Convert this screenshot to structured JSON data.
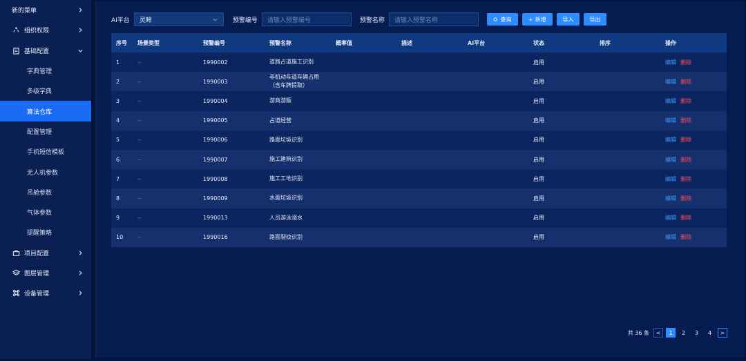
{
  "sidebar": {
    "items": [
      {
        "label": "新的菜单"
      },
      {
        "label": "组织权限"
      },
      {
        "label": "基础配置"
      },
      {
        "label": "项目配置"
      },
      {
        "label": "图层管理"
      },
      {
        "label": "设备管理"
      }
    ],
    "sub_items": [
      {
        "label": "字典管理"
      },
      {
        "label": "多级字典"
      },
      {
        "label": "算法仓库"
      },
      {
        "label": "配置管理"
      },
      {
        "label": "手机短信模板"
      },
      {
        "label": "无人机参数"
      },
      {
        "label": "吊舱参数"
      },
      {
        "label": "气体参数"
      },
      {
        "label": "提醒策略"
      }
    ]
  },
  "filters": {
    "platform_label": "AI平台",
    "platform_value": "灵眸",
    "code_label": "预警编号",
    "code_placeholder": "请输入预警编号",
    "name_label": "预警名称",
    "name_placeholder": "请输入预警名称",
    "query_label": "查询",
    "add_label": "新增",
    "import_label": "导入",
    "export_label": "导出"
  },
  "table": {
    "headers": [
      "序号",
      "场景类型",
      "预警编号",
      "预警名称",
      "概率值",
      "描述",
      "AI平台",
      "状态",
      "排序",
      "操作"
    ],
    "edit_label": "编辑",
    "delete_label": "删除",
    "rows": [
      {
        "idx": "1",
        "scene": "--",
        "code": "1990002",
        "name": "道路占道施工识别",
        "name2": "",
        "status": "启用"
      },
      {
        "idx": "2",
        "scene": "--",
        "code": "1990003",
        "name": "非机动车道车辆占用",
        "name2": "（含车牌提取）",
        "status": "启用"
      },
      {
        "idx": "3",
        "scene": "--",
        "code": "1990004",
        "name": "游商游贩",
        "name2": "",
        "status": "启用"
      },
      {
        "idx": "4",
        "scene": "--",
        "code": "1990005",
        "name": "占道经营",
        "name2": "",
        "status": "启用"
      },
      {
        "idx": "5",
        "scene": "--",
        "code": "1990006",
        "name": "路面垃圾识别",
        "name2": "",
        "status": "启用"
      },
      {
        "idx": "6",
        "scene": "--",
        "code": "1990007",
        "name": "施工建筑识别",
        "name2": "",
        "status": "启用"
      },
      {
        "idx": "7",
        "scene": "--",
        "code": "1990008",
        "name": "施工工地识别",
        "name2": "",
        "status": "启用"
      },
      {
        "idx": "8",
        "scene": "--",
        "code": "1990009",
        "name": "水面垃圾识别",
        "name2": "",
        "status": "启用"
      },
      {
        "idx": "9",
        "scene": "--",
        "code": "1990013",
        "name": "人员游泳溺水",
        "name2": "",
        "status": "启用"
      },
      {
        "idx": "10",
        "scene": "--",
        "code": "1990016",
        "name": "路面裂纹识别",
        "name2": "",
        "status": "启用"
      }
    ]
  },
  "pagination": {
    "total_text": "共 36 条",
    "prev": "<",
    "next": ">",
    "pages": [
      "1",
      "2",
      "3",
      "4"
    ],
    "current": "1"
  },
  "colors": {
    "accent": "#1a6cf5",
    "button": "#2e8dff",
    "delete": "#ff4d5a",
    "edit": "#3d9bff"
  }
}
